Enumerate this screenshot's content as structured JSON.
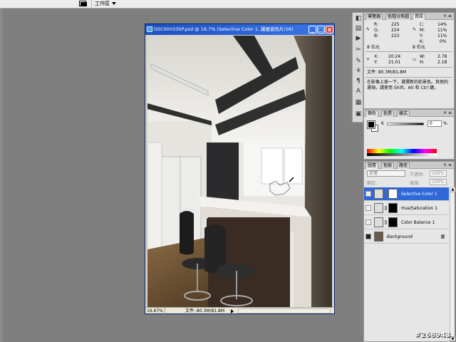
{
  "options_bar": {
    "tool_icon": "screen-mode-icon",
    "workspace_label": "工作區"
  },
  "document": {
    "title": "DSC00033SP.psd @ 16.7% (Selective Color 1, 圖層遮色片/16)",
    "zoom": "16.67%",
    "file_size": "文件: 80.3M/81.8M",
    "minimize": "_",
    "maximize": "□",
    "close": "x"
  },
  "tools": [
    "tool-a",
    "tool-b",
    "tool-c",
    "tool-d",
    "tool-e",
    "tool-f",
    "tool-g",
    "tool-h",
    "tool-i",
    "tool-j"
  ],
  "info_panel": {
    "tabs": [
      "導覽器",
      "色階分佈圖",
      "資訊"
    ],
    "active_tab": 2,
    "rgb": {
      "r_label": "R:",
      "r": "225",
      "g_label": "G:",
      "g": "224",
      "b_label": "B:",
      "b": "223"
    },
    "cmyk": {
      "c_label": "C:",
      "c": "14%",
      "m_label": "M:",
      "m": "11%",
      "y_label": "Y:",
      "y": "11%",
      "k_label": "K:",
      "k": "0%"
    },
    "bit_left": "8 位元",
    "bit_right": "8 位元",
    "pos": {
      "x_label": "X:",
      "x": "20.24",
      "y_label": "Y:",
      "y": "21.01"
    },
    "size": {
      "w_label": "W:",
      "w": "2.78",
      "h_label": "H:",
      "h": "2.18"
    },
    "doc_size": "文件: 80.3M/81.8M",
    "hint_line1": "在影像上按一下，選擇新的前景色。其他的",
    "hint_line2": "選項，請使用 Shift、Alt 和 Ctrl 鍵。"
  },
  "color_panel": {
    "tabs": [
      "顏色",
      "色票",
      "樣式"
    ],
    "active_tab": 0,
    "k_label": "K",
    "k_value": "0",
    "k_unit": "%"
  },
  "layers_panel": {
    "tabs": [
      "圖層",
      "色版",
      "路徑"
    ],
    "active_tab": 0,
    "blend_mode": "正常",
    "opacity_label": "不透明:",
    "opacity_value": "100%",
    "lock_label": "鎖定:",
    "fill_label": "填滿:",
    "fill_value": "100%",
    "layers": [
      {
        "name": "Selective Color 1",
        "selected": true,
        "thumb": "adjustment-icon",
        "has_mask": true
      },
      {
        "name": "Hue/Saturation 1",
        "selected": false,
        "thumb": "adjustment-icon",
        "has_mask": true
      },
      {
        "name": "Color Balance 1",
        "selected": false,
        "thumb": "adjustment-icon",
        "has_mask": true
      },
      {
        "name": "Background",
        "selected": false,
        "thumb": "photo-thumb",
        "has_mask": false,
        "locked": true
      }
    ]
  },
  "watermark": "#268943",
  "colors": {
    "workspace_bg": "#7f7f7f",
    "title_blue": "#2a5fd4",
    "selection_blue": "#3068d8",
    "panel_bg": "#e6e6e6"
  }
}
